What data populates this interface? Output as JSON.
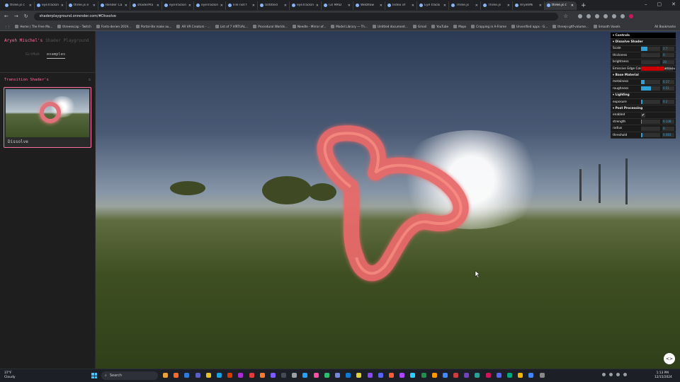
{
  "browser": {
    "tabs": [
      {
        "title": "three.js c"
      },
      {
        "title": "eyeTrackin"
      },
      {
        "title": "three.js e"
      },
      {
        "title": "Render Ca"
      },
      {
        "title": "shaderPla"
      },
      {
        "title": "eyeTrackin"
      },
      {
        "title": "eyeTrackin"
      },
      {
        "title": "File not f"
      },
      {
        "title": "Untitled"
      },
      {
        "title": "eyeTrackin"
      },
      {
        "title": "(3) MAD"
      },
      {
        "title": "Webflow"
      },
      {
        "title": "Index of"
      },
      {
        "title": "Eye tracki"
      },
      {
        "title": "Three.js"
      },
      {
        "title": "Three.js"
      },
      {
        "title": "AryehMi"
      },
      {
        "title": "three.js c",
        "active": true
      }
    ],
    "new_tab": "+",
    "url": "shaderplayground.onrender.com/#Dissolve",
    "bookmarks": [
      "Home | The Free Mo...",
      "threeescap - Twitch",
      "Fonts-derien 2019...",
      "Portal-lite make au...",
      "AR VR Creators - ...",
      "List of 7 VIRTUAL...",
      "Procedural Worlds...",
      "Needle - Mirror of...",
      "Model Library — Th...",
      "Untitled document...",
      "Gmail",
      "YouTube",
      "Maps",
      "Cropping in A-Frame",
      "Unverified apps - G...",
      "threejs-gltf-volume...",
      "Smooth Voxels"
    ],
    "all_bookmarks": "All Bookmarks"
  },
  "sidebar": {
    "brand": "Aryeh Mischel's",
    "brand_sub": "Shader Playground",
    "tabs": [
      "GitHub",
      "examples"
    ],
    "active_tab": "examples",
    "section_title": "Transition Shader's",
    "card_label": "Dissolve"
  },
  "controls": {
    "title": "Controls",
    "sections": [
      {
        "name": "Dissolve Shader",
        "rows": [
          {
            "label": "Scale",
            "value": "2.7",
            "fill": 0.35
          },
          {
            "label": "thickness",
            "value": "0",
            "fill": 0.0
          },
          {
            "label": "brightness",
            "value": "20",
            "fill": 0.0
          },
          {
            "label": "Emissive Edge Color",
            "hex": "#f31b1b",
            "color": "#cc0000"
          }
        ]
      },
      {
        "name": "Base Material",
        "rows": [
          {
            "label": "metalness",
            "value": "0.17",
            "fill": 0.17
          },
          {
            "label": "roughness",
            "value": "0.51",
            "fill": 0.51
          }
        ]
      },
      {
        "name": "Lighting",
        "rows": [
          {
            "label": "exposure",
            "value": "0.2",
            "fill": 0.08
          }
        ]
      },
      {
        "name": "Post Processing",
        "rows": [
          {
            "label": "enabled",
            "check": "✔"
          },
          {
            "label": "strength",
            "value": "0.138",
            "fill": 0.05
          },
          {
            "label": "radius",
            "value": "0",
            "fill": 0.0
          },
          {
            "label": "threshold",
            "value": "0.083",
            "fill": 0.08
          }
        ]
      }
    ]
  },
  "taskbar": {
    "temp": "37°F",
    "weather": "Cloudy",
    "search": "Search",
    "time": "1:13 PM",
    "date": "12/15/2024"
  },
  "colors": {
    "accent": "#ff6fa0",
    "slider": "#2fa1d6",
    "glow": "#ff6a6a"
  }
}
